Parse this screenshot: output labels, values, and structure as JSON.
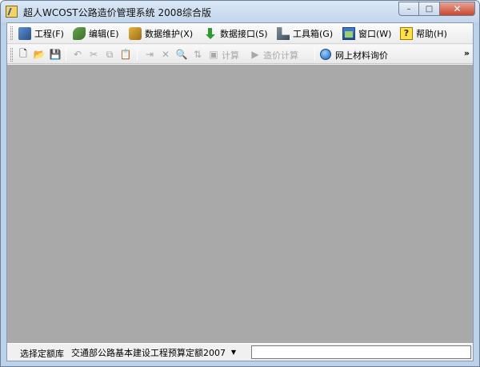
{
  "window": {
    "title": "超人WCOST公路造价管理系统 2008综合版",
    "controls": {
      "minimize": "–",
      "maximize": "□",
      "close": "✕"
    }
  },
  "menu": [
    {
      "label": "工程(F)",
      "icon": "project-icon"
    },
    {
      "label": "编辑(E)",
      "icon": "edit-icon"
    },
    {
      "label": "数据维护(X)",
      "icon": "data-maintenance-icon"
    },
    {
      "label": "数据接口(S)",
      "icon": "data-interface-icon"
    },
    {
      "label": "工具箱(G)",
      "icon": "toolbox-icon"
    },
    {
      "label": "窗口(W)",
      "icon": "window-icon"
    },
    {
      "label": "帮助(H)",
      "icon": "help-icon"
    }
  ],
  "toolbar": {
    "icons": {
      "new": "🗋",
      "open": "📂",
      "save": "💾",
      "undo": "↶",
      "cut": "✂",
      "copy": "⧉",
      "paste": "📋",
      "insert": "⇥",
      "delete": "✕",
      "find": "🔍",
      "sort": "⇅",
      "calc_icon": "▣",
      "run_icon": "▶"
    },
    "calc_label": "计算",
    "price_calc_label": "造价计算",
    "online_price_label": "网上材料询价",
    "overflow": "»"
  },
  "statusbar": {
    "quota_label": "选择定额库",
    "quota_value": "交通部公路基本建设工程预算定额2007",
    "dropdown_arrow": "▼"
  },
  "colors": {
    "title_bar": "#c3d6ec",
    "workspace": "#a9a9a9",
    "close_button": "#c9472d"
  }
}
